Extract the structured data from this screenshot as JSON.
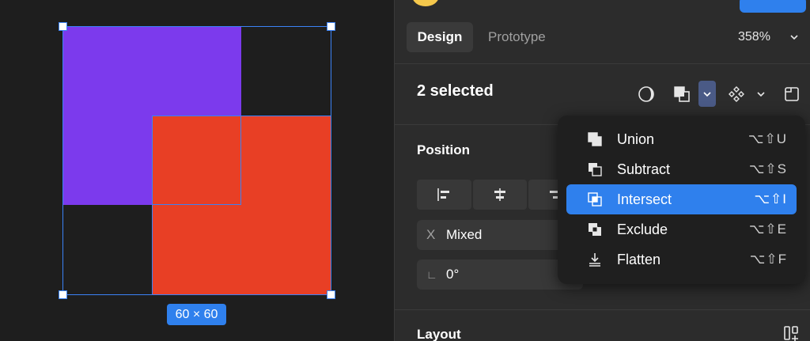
{
  "canvas": {
    "size_badge": "60 × 60",
    "shapes": [
      {
        "name": "purple-rect",
        "color": "#7c3aed"
      },
      {
        "name": "red-rect",
        "color": "#e83f25"
      }
    ],
    "selection_color": "#3b82f6"
  },
  "panel": {
    "tabs": [
      {
        "label": "Design",
        "active": true
      },
      {
        "label": "Prototype",
        "active": false
      }
    ],
    "zoom": "358%",
    "selection": {
      "label": "2 selected",
      "toolbar_icons": [
        "mask-icon",
        "boolean-icon",
        "chevron-down-icon",
        "component-icon",
        "chevron-down-icon",
        "frame-icon"
      ]
    },
    "position": {
      "title": "Position",
      "align_icons": [
        "align-left-icon",
        "align-horizontal-center-icon",
        "align-right-icon"
      ],
      "x_prefix": "X",
      "x_value": "Mixed",
      "rotation_prefix": "∟",
      "rotation_value": "0°"
    },
    "layout": {
      "title": "Layout"
    }
  },
  "boolean_menu": {
    "items": [
      {
        "label": "Union",
        "shortcut": "⌥⇧U",
        "icon": "union-icon",
        "active": false
      },
      {
        "label": "Subtract",
        "shortcut": "⌥⇧S",
        "icon": "subtract-icon",
        "active": false
      },
      {
        "label": "Intersect",
        "shortcut": "⌥⇧I",
        "icon": "intersect-icon",
        "active": true
      },
      {
        "label": "Exclude",
        "shortcut": "⌥⇧E",
        "icon": "exclude-icon",
        "active": false
      },
      {
        "label": "Flatten",
        "shortcut": "⌥⇧F",
        "icon": "flatten-icon",
        "active": false
      }
    ]
  },
  "colors": {
    "accent": "#2f80ed",
    "canvas_bg": "#1e1e1e",
    "panel_bg": "#2c2c2c"
  }
}
